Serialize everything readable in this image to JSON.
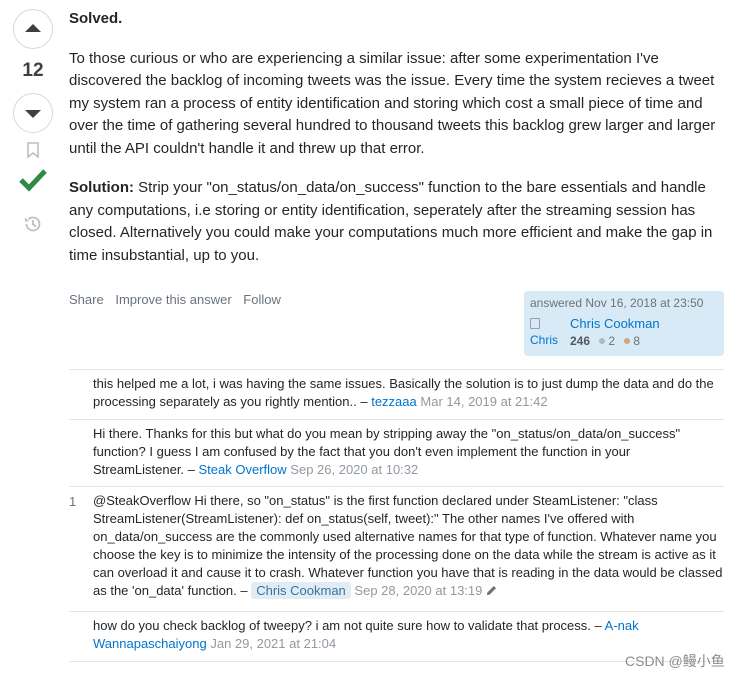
{
  "vote": {
    "count": "12"
  },
  "answer": {
    "solved_label": "Solved.",
    "paragraph_1": "To those curious or who are experiencing a similar issue: after some experimentation I've discovered the backlog of incoming tweets was the issue. Every time the system recieves a tweet my system ran a process of entity identification and storing which cost a small piece of time and over the time of gathering several hundred to thousand tweets this backlog grew larger and larger until the API couldn't handle it and threw up that error.",
    "solution_label": "Solution:",
    "solution_text": "Strip your \"on_status/on_data/on_success\" function to the bare essentials and handle any computations, i.e storing or entity identification, seperately after the streaming session has closed. Alternatively you could make your computations much more efficient and make the gap in time insubstantial, up to you."
  },
  "menu": {
    "share": "Share",
    "improve": "Improve this answer",
    "follow": "Follow"
  },
  "signature": {
    "answered": "answered Nov 16, 2018 at 23:50",
    "avatar_alt": "Chris Cookman",
    "name": "Chris Cookman",
    "reputation": "246",
    "silver": "2",
    "bronze": "8",
    "colors": {
      "silver": "#b4b8bc",
      "bronze": "#d1a684"
    }
  },
  "comments": [
    {
      "score": "",
      "text": "this helped me a lot, i was having the same issues. Basically the solution is to just dump the data and do the processing separately as you rightly mention.. –",
      "author": "tezzaaa",
      "date": "Mar 14, 2019 at 21:42"
    },
    {
      "score": "",
      "text": "Hi there. Thanks for this but what do you mean by stripping away the \"on_status/on_data/on_success\" function? I guess I am confused by the fact that you don't even implement the function in your StreamListener. –",
      "author": "Steak Overflow",
      "date": "Sep 26, 2020 at 10:32"
    },
    {
      "score": "1",
      "text": "@SteakOverflow Hi there, so \"on_status\" is the first function declared under SteamListener: \"class StreamListener(StreamListener): def on_status(self, tweet):\" The other names I've offered with on_data/on_success are the commonly used alternative names for that type of function. Whatever name you choose the key is to minimize the intensity of the processing done on the data while the stream is active as it can overload it and cause it to crash. Whatever function you have that is reading in the data would be classed as the 'on_data' function. –",
      "author": "Chris Cookman",
      "date": "Sep 28, 2020 at 13:19"
    },
    {
      "score": "",
      "text": "how do you check backlog of tweepy? i am not quite sure how to validate that process. –",
      "author": "A-nak Wannapaschaiyong",
      "date": "Jan 29, 2021 at 21:04"
    }
  ],
  "watermark": "CSDN @鳗小鱼",
  "icons": {
    "upvote": "arrow-up-icon",
    "downvote": "arrow-down-icon",
    "bookmark": "bookmark-icon",
    "accepted": "checkmark-icon",
    "history": "history-icon",
    "edit": "pencil-icon"
  },
  "colors": {
    "accepted": "#2f8a48",
    "link": "#0074cc",
    "signature_bg": "#d9eaf7"
  }
}
